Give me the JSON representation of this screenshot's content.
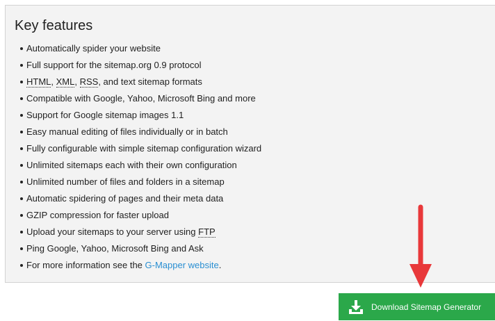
{
  "panel": {
    "title": "Key features",
    "features": [
      {
        "text": "Automatically spider your website"
      },
      {
        "text": "Full support for the sitemap.org 0.9 protocol"
      },
      {
        "parts": [
          "HTML",
          ", ",
          "XML",
          ", ",
          "RSS",
          ", and text sitemap formats"
        ]
      },
      {
        "text": "Compatible with Google, Yahoo, Microsoft Bing and more"
      },
      {
        "text": "Support for Google sitemap images 1.1"
      },
      {
        "text": "Easy manual editing of files individually or in batch"
      },
      {
        "text": "Fully configurable with simple sitemap configuration wizard"
      },
      {
        "text": "Unlimited sitemaps each with their own configuration"
      },
      {
        "text": "Unlimited number of files and folders in a sitemap"
      },
      {
        "text": "Automatic spidering of pages and their meta data"
      },
      {
        "text": "GZIP compression for faster upload"
      },
      {
        "parts": [
          "Upload your sitemaps to your server using ",
          "FTP"
        ]
      },
      {
        "text": "Ping Google, Yahoo, Microsoft Bing and Ask"
      },
      {
        "parts": [
          "For more information see the ",
          "G-Mapper website",
          "."
        ]
      }
    ]
  },
  "download_button": {
    "label": "Download Sitemap Generator",
    "icon": "download-icon"
  },
  "annotation": {
    "icon": "arrow-down-icon"
  },
  "colors": {
    "panel_background": "#f3f3f3",
    "button_green": "#2ba84a",
    "link_blue": "#2a8fd2",
    "arrow_red": "#e8383a"
  }
}
